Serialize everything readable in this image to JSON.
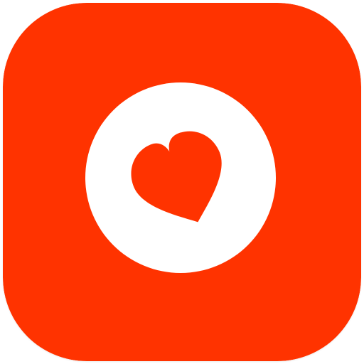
{
  "app_icon": {
    "name": "heart-app-icon",
    "colors": {
      "tile": "#ff3300",
      "circle": "#ffffff",
      "heart": "#ff3300"
    },
    "glyph": "heart-icon"
  }
}
